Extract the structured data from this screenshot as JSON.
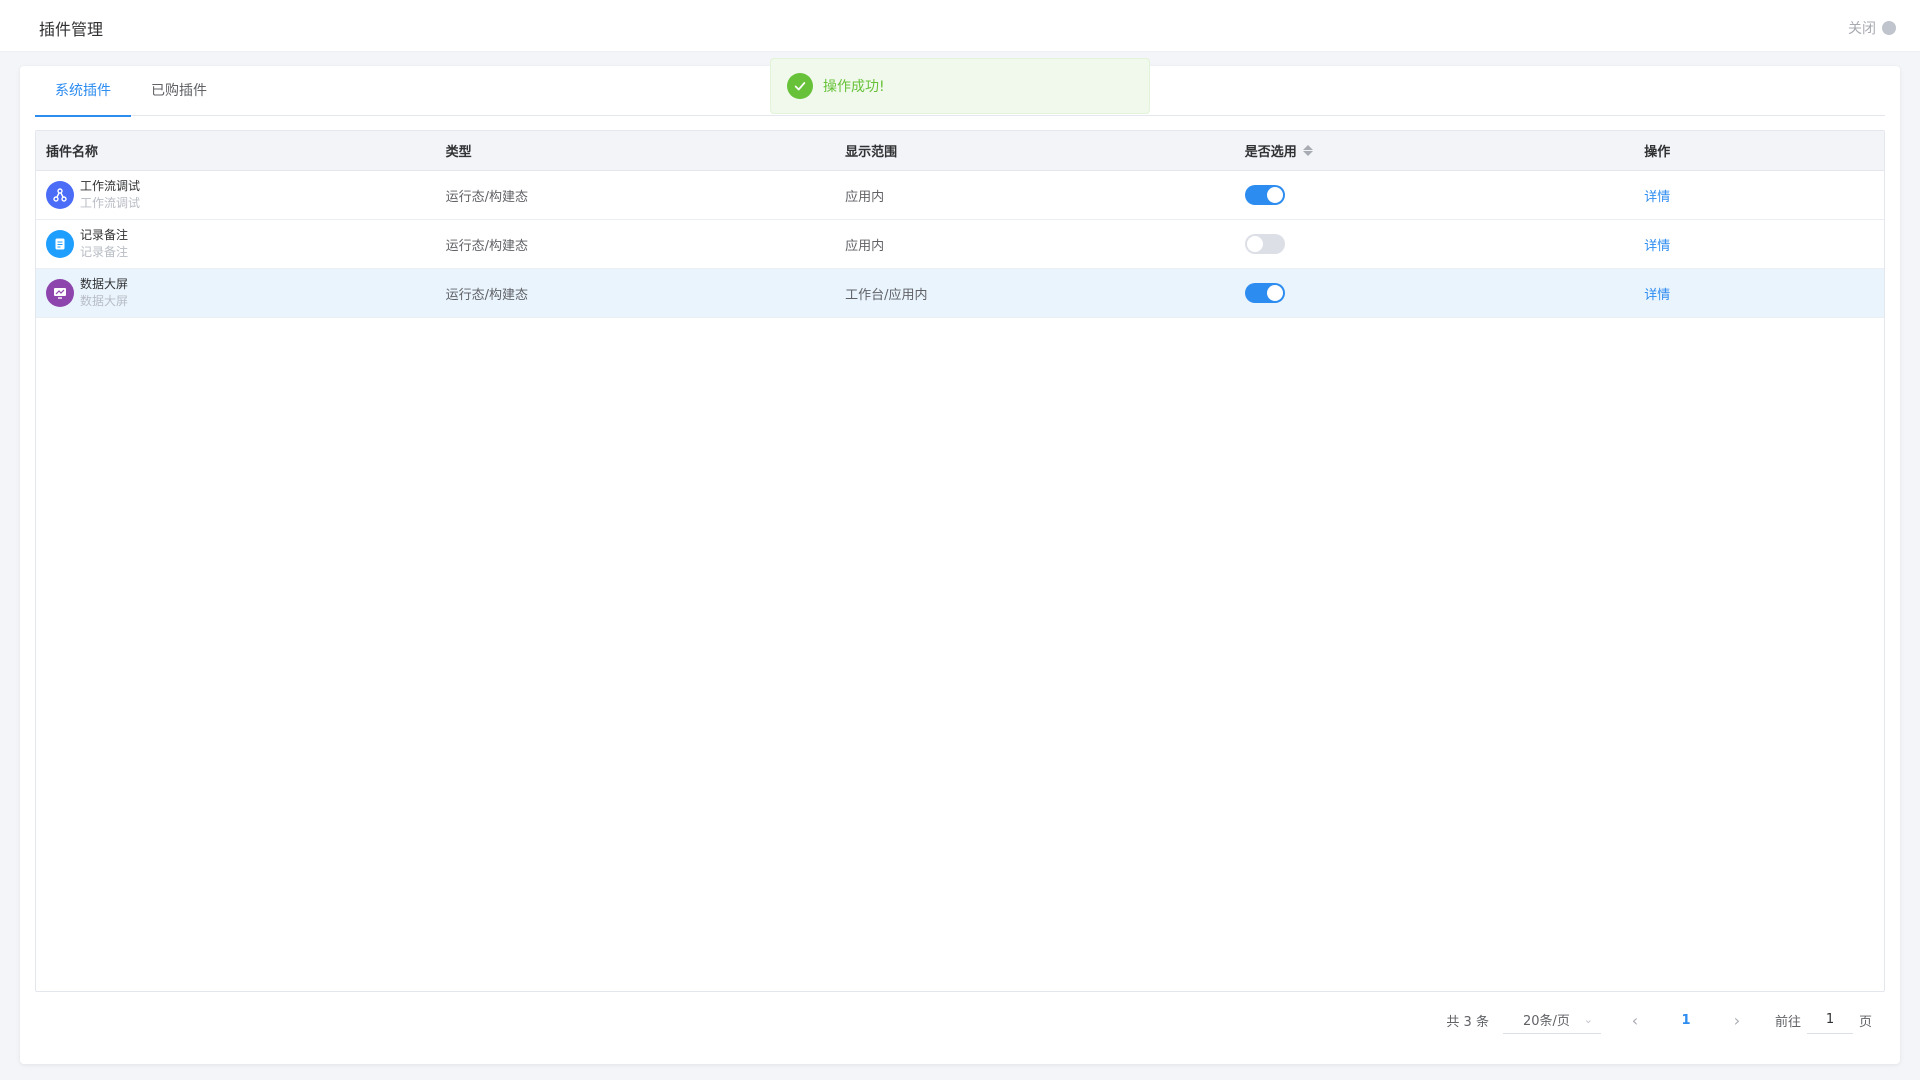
{
  "header": {
    "title": "插件管理",
    "close_label": "关闭"
  },
  "tabs": [
    {
      "label": "系统插件",
      "active": true
    },
    {
      "label": "已购插件",
      "active": false
    }
  ],
  "table": {
    "columns": [
      "插件名称",
      "类型",
      "显示范围",
      "是否选用",
      "操作"
    ],
    "rows": [
      {
        "name": "工作流调试",
        "sub": "工作流调试",
        "type": "运行态/构建态",
        "scope": "应用内",
        "enabled": true,
        "action": "详情",
        "icon": "workflow-icon",
        "icon_color": "#4a6cf7"
      },
      {
        "name": "记录备注",
        "sub": "记录备注",
        "type": "运行态/构建态",
        "scope": "应用内",
        "enabled": false,
        "action": "详情",
        "icon": "note-icon",
        "icon_color": "#1e9fff"
      },
      {
        "name": "数据大屏",
        "sub": "数据大屏",
        "type": "运行态/构建态",
        "scope": "工作台/应用内",
        "enabled": true,
        "action": "详情",
        "icon": "dashboard-icon",
        "icon_color": "#8e44ad"
      }
    ]
  },
  "pagination": {
    "total": "共 3 条",
    "page_size": "20条/页",
    "current_page": "1",
    "goto_label": "前往",
    "goto_value": "1",
    "page_suffix": "页"
  },
  "toast": {
    "message": "操作成功!"
  },
  "colors": {
    "accent": "#2d8cf0",
    "success": "#67c23a"
  }
}
